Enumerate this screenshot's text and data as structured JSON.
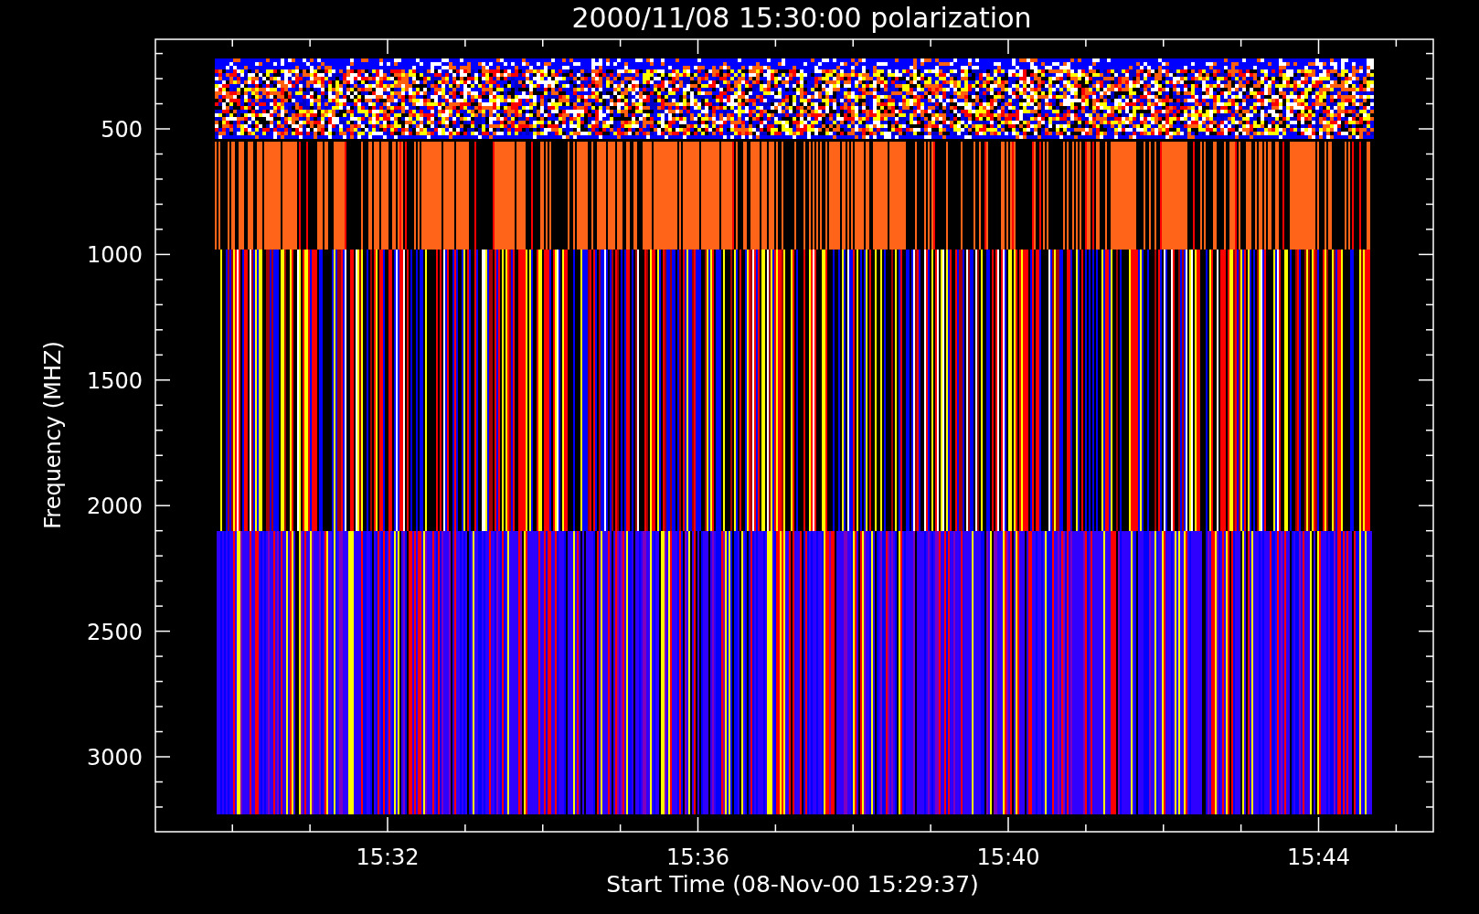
{
  "title": "2000/11/08 15:30:00 polarization",
  "y_axis": {
    "label": "Frequency (MHZ)",
    "ticks": [
      "500",
      "1000",
      "1500",
      "2000",
      "2500",
      "3000"
    ]
  },
  "x_axis": {
    "label": "Start Time (08-Nov-00 15:29:37)",
    "ticks": [
      "15:32",
      "15:36",
      "15:40",
      "15:44"
    ]
  }
}
